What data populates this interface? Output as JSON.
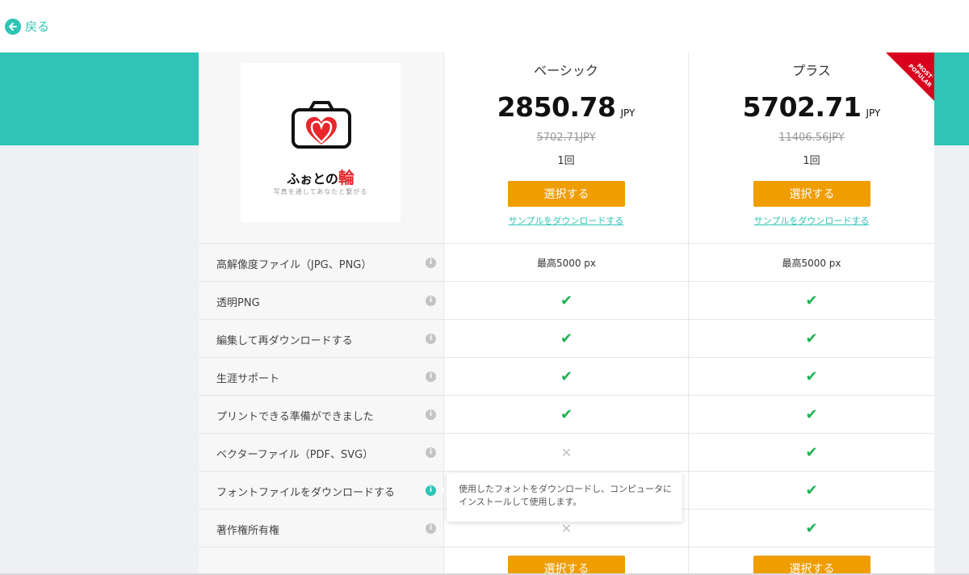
{
  "nav": {
    "back_label": "戻る"
  },
  "logo": {
    "brand_prefix": "ふぉとの",
    "brand_accent": "輪",
    "tagline": "写真を通してあなたと繋がる"
  },
  "plans": [
    {
      "name": "ベーシック",
      "price": "2850.78",
      "currency": "JPY",
      "original_price": "5702.71JPY",
      "downloads": "1回",
      "select_label": "選択する",
      "sample_label": "サンプルをダウンロードする"
    },
    {
      "name": "プラス",
      "price": "5702.71",
      "currency": "JPY",
      "original_price": "11406.56JPY",
      "downloads": "1回",
      "select_label": "選択する",
      "sample_label": "サンプルをダウンロードする",
      "ribbon_line1": "MOST",
      "ribbon_line2": "POPULAR"
    }
  ],
  "features": [
    {
      "label": "高解像度ファイル（JPG、PNG）",
      "basic": "最高5000 px",
      "plus": "最高5000 px"
    },
    {
      "label": "透明PNG",
      "basic": "check",
      "plus": "check"
    },
    {
      "label": "編集して再ダウンロードする",
      "basic": "check",
      "plus": "check"
    },
    {
      "label": "生涯サポート",
      "basic": "check",
      "plus": "check"
    },
    {
      "label": "プリントできる準備ができました",
      "basic": "check",
      "plus": "check"
    },
    {
      "label": "ベクターファイル（PDF、SVG）",
      "basic": "cross",
      "plus": "check"
    },
    {
      "label": "フォントファイルをダウンロードする",
      "basic": "",
      "plus": "check"
    },
    {
      "label": "著作権所有権",
      "basic": "cross",
      "plus": "check"
    }
  ],
  "tooltip": {
    "text": "使用したフォントをダウンロードし、コンピュータにインストールして使用します。"
  },
  "colors": {
    "accent": "#2ec4b6",
    "button": "#f09d00",
    "check": "#1fb254",
    "ribbon": "#d8001d"
  },
  "icons": {
    "info": "i",
    "check": "✔",
    "cross": "✕",
    "back": "arrow-left"
  }
}
